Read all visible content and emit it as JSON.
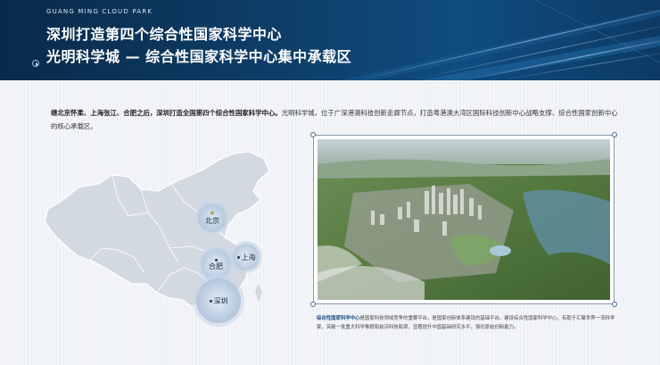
{
  "header": {
    "brand": "GUANG MING CLOUD PARK",
    "title_line1": "深圳打造第四个综合性国家科学中心",
    "title_line2": "光明科学城 — 综合性国家科学中心集中承载区"
  },
  "intro": {
    "bold_part": "继北京怀柔、上海张江、合肥之后，深圳打造全国第四个综合性国家科学中心。",
    "rest": "光明科学城，位于广深港澳科技创新走廊节点，打造粤港澳大湾区国际科技创新中心战略支撑、综合性国家创新中心的核心承载区。"
  },
  "map": {
    "cities": {
      "beijing": "北京",
      "hefei": "合肥",
      "shanghai": "上海",
      "shenzhen": "深圳"
    }
  },
  "caption": {
    "bold_part": "综合性国家科学中心",
    "rest": "是国家科技领域竞争的重要平台，是国家创新体系建设的基础平台。建设综合性国家科学中心，有助于汇聚世界一流科学家，突破一批重大科学难题和前沿科技瓶颈，显著提升中国基础研究水平，强化原始创新能力。"
  },
  "colors": {
    "header_dark": "#0a2a4a",
    "header_mid": "#0f4c80",
    "map_fill": "#d3d9e1",
    "accent_blue": "#1f4f85"
  }
}
